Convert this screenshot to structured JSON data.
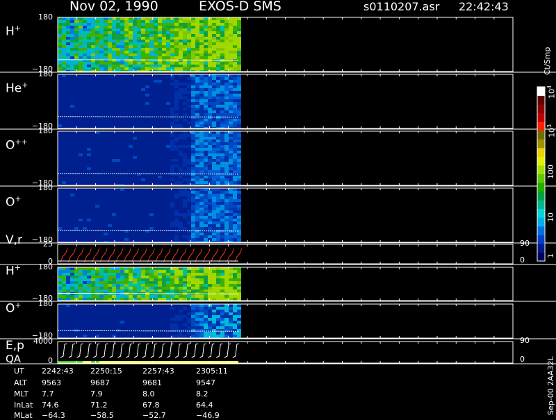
{
  "header": {
    "date": "Nov 02, 1990",
    "instrument": "EXOS-D SMS",
    "file": "s0110207.asr",
    "time": "22:42:43"
  },
  "colorbar": {
    "title": "Ct/Smp",
    "ticks": [
      {
        "base": "10",
        "exp": "4"
      },
      {
        "base": "10",
        "exp": "3"
      },
      {
        "base": "100",
        "exp": ""
      },
      {
        "base": "10",
        "exp": ""
      },
      {
        "base": "1",
        "exp": ""
      }
    ],
    "colors": [
      "#000060",
      "#001a8c",
      "#0040c8",
      "#0070e0",
      "#00b0e8",
      "#00d8d8",
      "#00b890",
      "#00a040",
      "#20b000",
      "#60c800",
      "#a0e000",
      "#e0f000",
      "#f0d000",
      "#a09000",
      "#707000",
      "#ff2000",
      "#c00000",
      "#900000",
      "#600000",
      "#ffffff"
    ]
  },
  "side_id": "Sep-00  2AA32L",
  "panels": [
    {
      "id": "hplus1",
      "label": "H",
      "sup": "+",
      "ymax": "180",
      "ymin": "−180",
      "color_scheme": "green"
    },
    {
      "id": "heplus",
      "label": "He",
      "sup": "+",
      "ymax": "180",
      "ymin": "−180",
      "color_scheme": "blue"
    },
    {
      "id": "oplusplus",
      "label": "O",
      "sup": "++",
      "ymax": "180",
      "ymin": "−180",
      "color_scheme": "blue"
    },
    {
      "id": "oplus1",
      "label": "O",
      "sup": "+",
      "ymax": "180",
      "ymin": "−180",
      "color_scheme": "blue"
    },
    {
      "id": "vr",
      "label": "V,r",
      "sup": "",
      "ymax": "25",
      "ymin": "0",
      "rmax": "90",
      "rmin": "0"
    },
    {
      "id": "hplus2",
      "label": "H",
      "sup": "+",
      "ymax": "180",
      "ymin": "−180",
      "color_scheme": "green"
    },
    {
      "id": "oplus2",
      "label": "O",
      "sup": "+",
      "ymax": "180",
      "ymin": "−180",
      "color_scheme": "mixed"
    },
    {
      "id": "ep",
      "label": "E,p",
      "label2": "QA",
      "ymax": "4000",
      "ymin": "0",
      "rmax": "90",
      "rmin": "0"
    }
  ],
  "ephemeris": {
    "labels": [
      "UT",
      "ALT",
      "MLT",
      "InLat",
      "MLat"
    ],
    "rows": [
      [
        "2242:43",
        "2250:15",
        "2257:43",
        "2305:11"
      ],
      [
        "9563",
        "9687",
        "9681",
        "9547"
      ],
      [
        "7.7",
        "7.9",
        "8.0",
        "8.2"
      ],
      [
        "74.6",
        "71.2",
        "67.8",
        "64.4"
      ],
      [
        "−64.3",
        "−58.5",
        "−52.7",
        "−46.9"
      ]
    ]
  },
  "chart_data": {
    "type": "heatmap",
    "title": "Nov 02, 1990   EXOS-D SMS",
    "x_ticks_UT": [
      "2242:43",
      "2250:15",
      "2257:43",
      "2305:11"
    ],
    "series": [
      {
        "name": "H+",
        "ylim": [
          -180,
          180
        ]
      },
      {
        "name": "He+",
        "ylim": [
          -180,
          180
        ]
      },
      {
        "name": "O++",
        "ylim": [
          -180,
          180
        ]
      },
      {
        "name": "O+",
        "ylim": [
          -180,
          180
        ]
      },
      {
        "name": "V,r",
        "ylim": [
          0,
          25
        ],
        "right_ylim": [
          0,
          90
        ]
      },
      {
        "name": "H+",
        "ylim": [
          -180,
          180
        ]
      },
      {
        "name": "O+",
        "ylim": [
          -180,
          180
        ]
      },
      {
        "name": "E,p",
        "ylim": [
          0,
          4000
        ],
        "right_ylim": [
          0,
          90
        ]
      }
    ],
    "colorbar_range": [
      1,
      10000
    ],
    "colorbar_units": "Ct/Smp",
    "grid": true
  }
}
